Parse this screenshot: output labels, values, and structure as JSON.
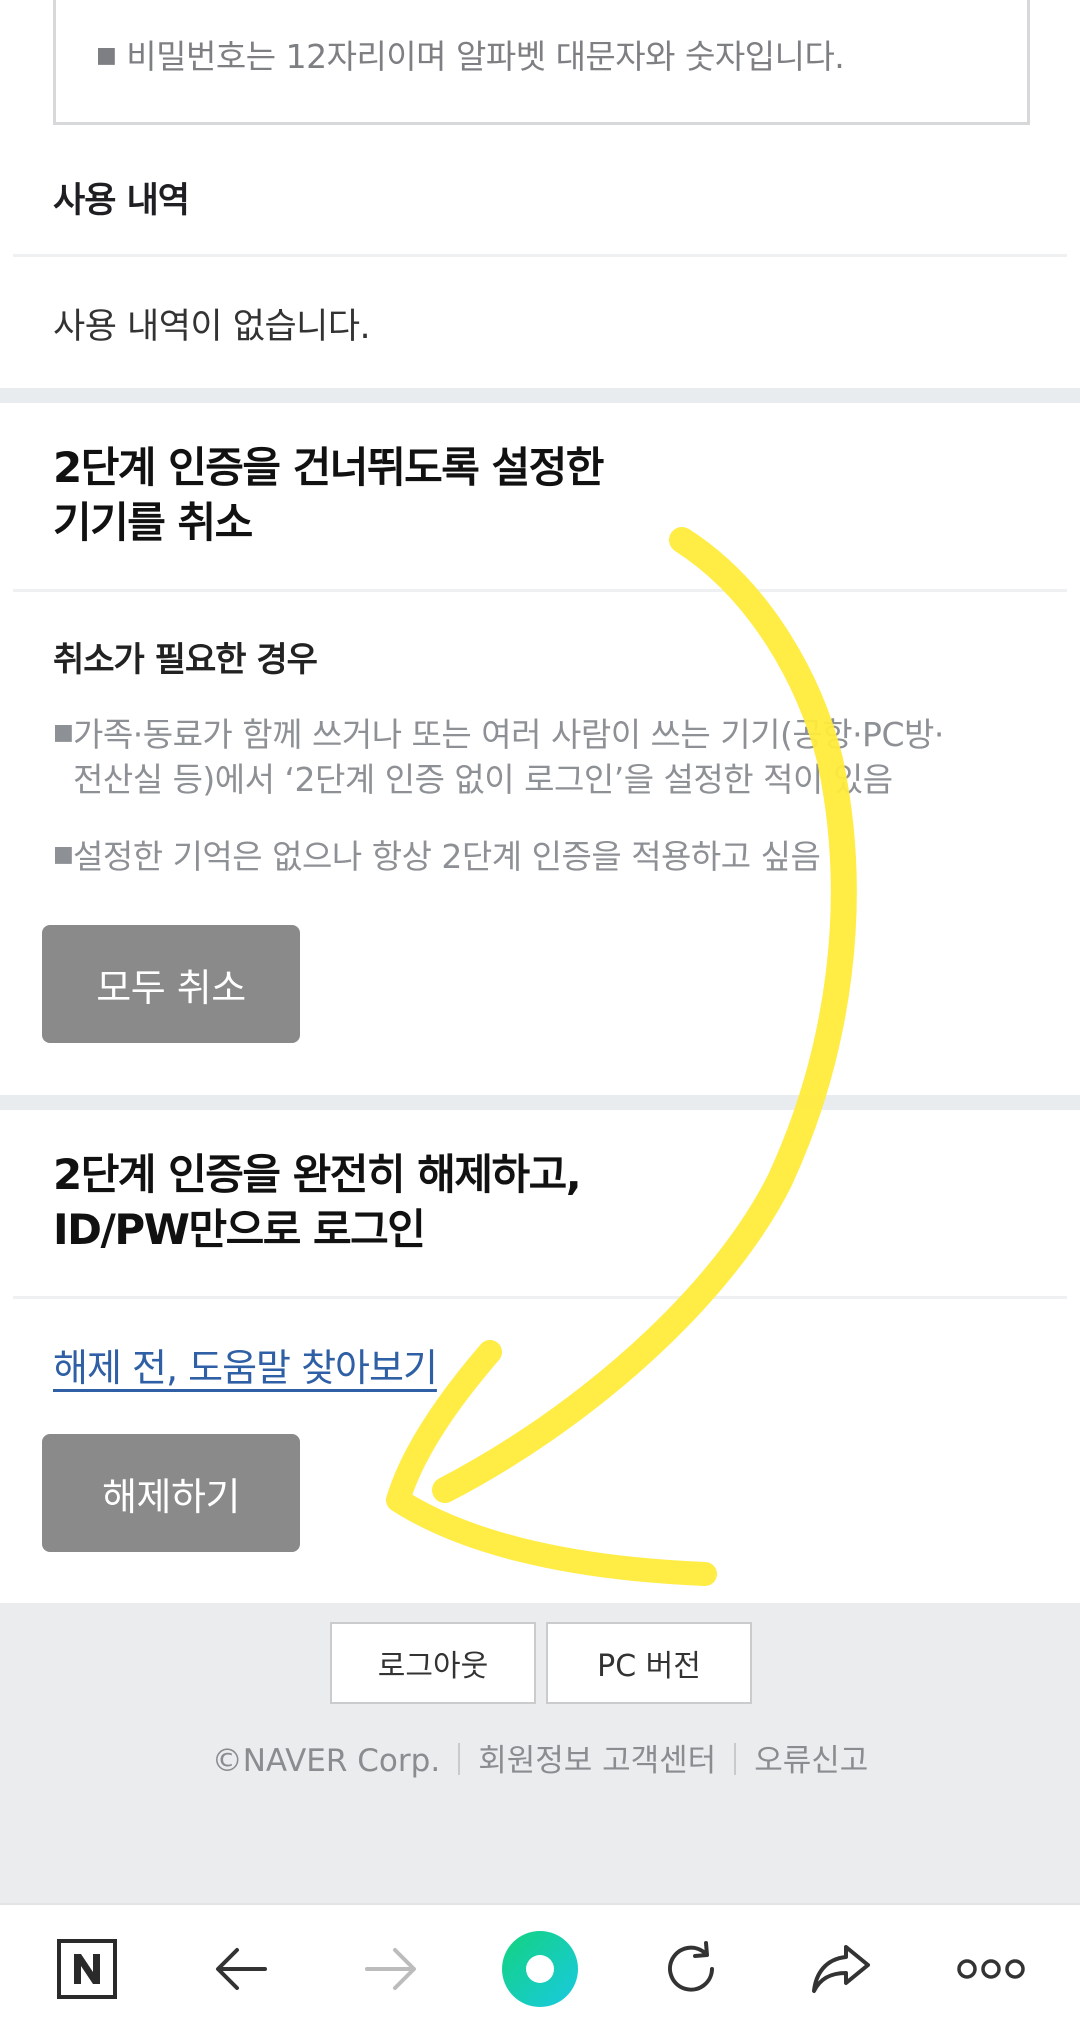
{
  "password_notice": {
    "text": "비밀번호는 12자리이며 알파벳 대문자와 숫자입니다."
  },
  "usage": {
    "title": "사용 내역",
    "empty_text": "사용 내역이 없습니다."
  },
  "cancel_section": {
    "title_line1": "2단계 인증을 건너뛰도록 설정한",
    "title_line2": "기기를 취소",
    "subtitle": "취소가 필요한 경우",
    "bullets": [
      {
        "line1": "가족·동료가 함께 쓰거나 또는 여러 사람이 쓰는 기기(공항·PC방·",
        "line2": "전산실 등)에서 ‘2단계 인증 없이 로그인’을 설정한 적이 있음"
      },
      {
        "line1": "설정한 기억은 없으나 항상 2단계 인증을 적용하고 싶음"
      }
    ],
    "button_label": "모두 취소"
  },
  "disable_section": {
    "title_line1": "2단계 인증을 완전히 해제하고,",
    "title_line2": "ID/PW만으로 로그인",
    "help_link": "해제 전, 도움말 찾아보기",
    "button_label": "해제하기"
  },
  "footer": {
    "logout_label": "로그아웃",
    "pc_version_label": "PC 버전",
    "copyright": "©NAVER Corp.",
    "member_center": "회원정보 고객센터",
    "report_error": "오류신고"
  },
  "bottom_nav": {
    "icons": [
      "naver-home-icon",
      "back-arrow-icon",
      "forward-arrow-icon",
      "green-dot-icon",
      "refresh-icon",
      "share-icon",
      "more-icon"
    ]
  },
  "colors": {
    "annotation": "#ffeb3b",
    "link": "#2f5fa4",
    "button_gray": "#8a8a8a",
    "green_dot_start": "#13d37e",
    "green_dot_end": "#19c9e2"
  }
}
